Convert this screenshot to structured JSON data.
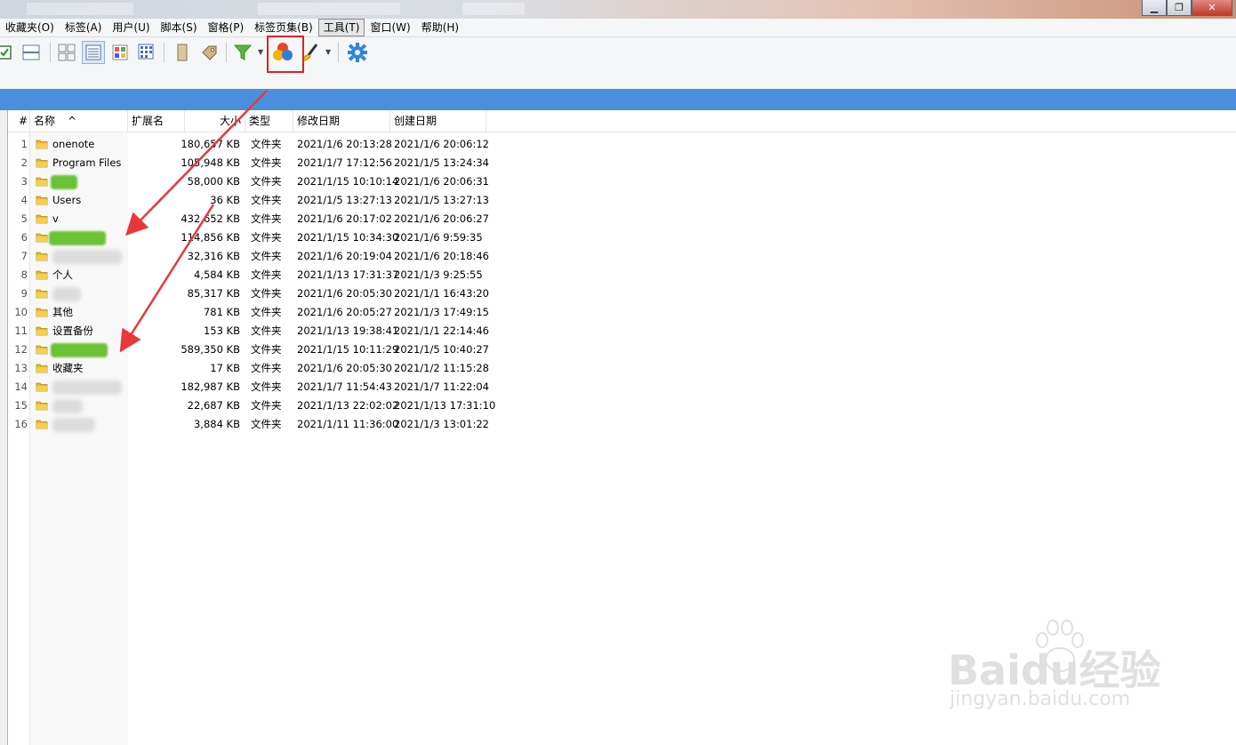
{
  "menu": {
    "items": [
      "收藏夹(O)",
      "标签(A)",
      "用户(U)",
      "脚本(S)",
      "窗格(P)",
      "标签页集(B)",
      "工具(T)",
      "窗口(W)",
      "帮助(H)"
    ],
    "active_index": 6
  },
  "window_buttons": {
    "minimize": "▁",
    "restore": "❐",
    "close": "✕"
  },
  "toolbar": {
    "icons": [
      "checkbox-icon",
      "split-pane-icon",
      "grid-view-icon",
      "details-view-icon",
      "thumbnail-view-icon",
      "list-view-icon",
      "bookmark-icon",
      "tag-icon",
      "filter-icon",
      "color-filter-icon",
      "brush-icon",
      "settings-gear-icon"
    ],
    "highlighted": "color-filter-icon"
  },
  "table": {
    "headers": {
      "num": "#",
      "name": "名称",
      "ext": "扩展名",
      "size": "大小",
      "type": "类型",
      "modified": "修改日期",
      "created": "创建日期"
    },
    "sort_indicator": "^",
    "rows": [
      {
        "num": "1",
        "name": "onenote",
        "size": "180,657 KB",
        "type": "文件夹",
        "modified": "2021/1/6 20:13:28",
        "created": "2021/1/6 20:06:12"
      },
      {
        "num": "2",
        "name": "Program Files",
        "size": "105,948 KB",
        "type": "文件夹",
        "modified": "2021/1/7 17:12:56",
        "created": "2021/1/5 13:24:34"
      },
      {
        "num": "3",
        "name": "",
        "size": "58,000 KB",
        "type": "文件夹",
        "modified": "2021/1/15 10:10:14",
        "created": "2021/1/6 20:06:31"
      },
      {
        "num": "4",
        "name": "Users",
        "size": "36 KB",
        "type": "文件夹",
        "modified": "2021/1/5 13:27:13",
        "created": "2021/1/5 13:27:13"
      },
      {
        "num": "5",
        "name": "v",
        "size": "432,652 KB",
        "type": "文件夹",
        "modified": "2021/1/6 20:17:02",
        "created": "2021/1/6 20:06:27"
      },
      {
        "num": "6",
        "name": "",
        "size": "114,856 KB",
        "type": "文件夹",
        "modified": "2021/1/15 10:34:30",
        "created": "2021/1/6 9:59:35"
      },
      {
        "num": "7",
        "name": "",
        "size": "32,316 KB",
        "type": "文件夹",
        "modified": "2021/1/6 20:19:04",
        "created": "2021/1/6 20:18:46"
      },
      {
        "num": "8",
        "name": "个人",
        "size": "4,584 KB",
        "type": "文件夹",
        "modified": "2021/1/13 17:31:37",
        "created": "2021/1/3 9:25:55"
      },
      {
        "num": "9",
        "name": "",
        "size": "85,317 KB",
        "type": "文件夹",
        "modified": "2021/1/6 20:05:30",
        "created": "2021/1/1 16:43:20"
      },
      {
        "num": "10",
        "name": "其他",
        "size": "781 KB",
        "type": "文件夹",
        "modified": "2021/1/6 20:05:27",
        "created": "2021/1/3 17:49:15"
      },
      {
        "num": "11",
        "name": "设置备份",
        "size": "153 KB",
        "type": "文件夹",
        "modified": "2021/1/13 19:38:41",
        "created": "2021/1/1 22:14:46"
      },
      {
        "num": "12",
        "name": "",
        "size": "589,350 KB",
        "type": "文件夹",
        "modified": "2021/1/15 10:11:29",
        "created": "2021/1/5 10:40:27"
      },
      {
        "num": "13",
        "name": "收藏夹",
        "size": "17 KB",
        "type": "文件夹",
        "modified": "2021/1/6 20:05:30",
        "created": "2021/1/2 11:15:28"
      },
      {
        "num": "14",
        "name": "",
        "size": "182,987 KB",
        "type": "文件夹",
        "modified": "2021/1/7 11:54:43",
        "created": "2021/1/7 11:22:04"
      },
      {
        "num": "15",
        "name": "",
        "size": "22,687 KB",
        "type": "文件夹",
        "modified": "2021/1/13 22:02:02",
        "created": "2021/1/13 17:31:10"
      },
      {
        "num": "16",
        "name": "",
        "size": "3,884 KB",
        "type": "文件夹",
        "modified": "2021/1/11 11:36:00",
        "created": "2021/1/3 13:01:22"
      }
    ]
  },
  "watermark": {
    "brand": "Baidu经验",
    "url": "jingyan.baidu.com"
  },
  "colors": {
    "accent_bar": "#4a8fdc",
    "highlight_box": "#e02020",
    "arrow": "#e8383b",
    "folder": "#e8b92c"
  }
}
